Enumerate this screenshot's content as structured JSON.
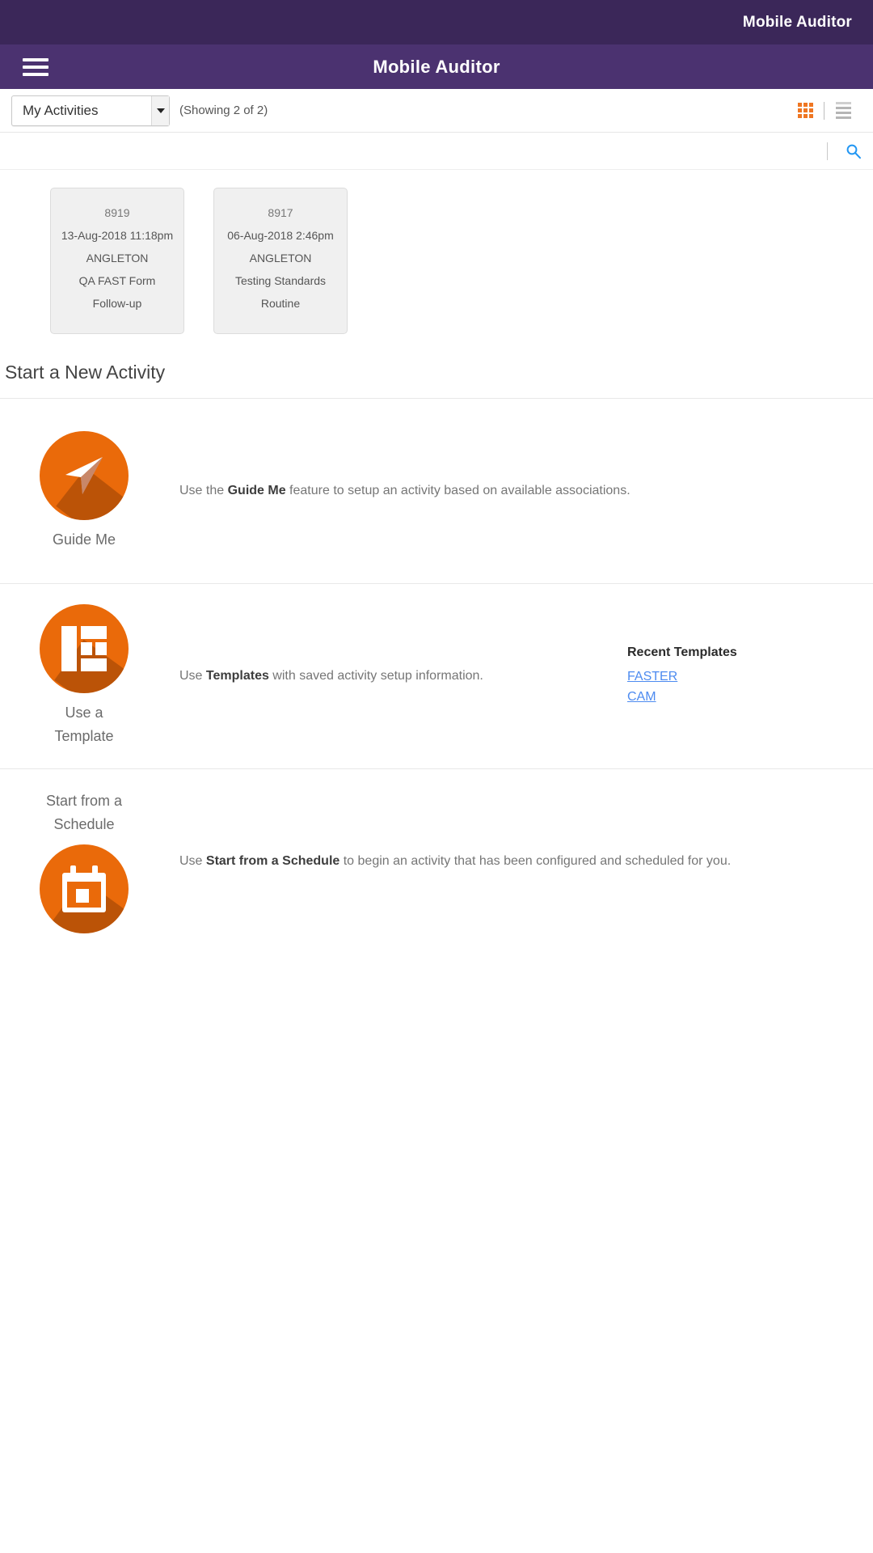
{
  "status_bar": {
    "title": "Mobile Auditor"
  },
  "app_bar": {
    "title": "Mobile Auditor",
    "menu_icon": "hamburger-menu-icon"
  },
  "toolbar": {
    "filter_selected": "My Activities",
    "filter_options": [
      "My Activities"
    ],
    "showing_text": "(Showing 2 of 2)",
    "grid_view_icon": "grid-view-icon",
    "list_view_icon": "list-view-icon",
    "search_icon": "search-icon",
    "active_view": "grid"
  },
  "activities": [
    {
      "id": "8919",
      "datetime": "13-Aug-2018 11:18pm",
      "location": "ANGLETON",
      "form": "QA FAST Form",
      "type": "Follow-up"
    },
    {
      "id": "8917",
      "datetime": "06-Aug-2018 2:46pm",
      "location": "ANGLETON",
      "form": "Testing Standards",
      "type": "Routine"
    }
  ],
  "new_activity": {
    "heading": "Start a New Activity",
    "options": [
      {
        "caption": "Guide Me",
        "icon": "paper-plane-icon",
        "desc_pre": "Use the ",
        "desc_bold": "Guide Me",
        "desc_post": " feature to setup an activity based on available associations."
      },
      {
        "caption": "Use a\nTemplate",
        "icon": "template-layout-icon",
        "desc_pre": "Use ",
        "desc_bold": "Templates",
        "desc_post": " with saved activity setup information.",
        "recent": {
          "title": "Recent Templates",
          "links": [
            "FASTER",
            "CAM"
          ]
        }
      },
      {
        "caption": "Start from a\nSchedule",
        "icon": "calendar-icon",
        "desc_pre": "Use ",
        "desc_bold": "Start from a Schedule",
        "desc_post": " to begin an activity that has been configured and scheduled for you."
      }
    ]
  },
  "colors": {
    "status_bar_purple": "#3b2759",
    "app_bar_purple": "#4b3270",
    "accent_orange": "#ea6a0a",
    "grid_icon_orange": "#ef7622",
    "link_blue": "#4d8bf0",
    "search_blue": "#2196f3",
    "card_gray": "#f0f0f0"
  }
}
